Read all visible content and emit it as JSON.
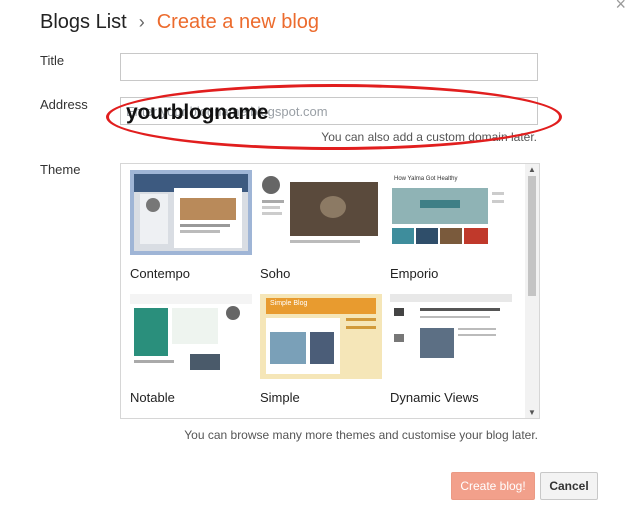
{
  "breadcrumb": {
    "parent": "Blogs List",
    "separator": "›",
    "current": "Create a new blog"
  },
  "close_glyph": "×",
  "form": {
    "title_label": "Title",
    "title_value": "",
    "address_label": "Address",
    "address_placeholder": "Enter your blogname.blogspot.com",
    "address_overlay": "yourblogname",
    "address_hint": "You can also add a custom domain later.",
    "theme_label": "Theme"
  },
  "themes": [
    {
      "name": "Contempo",
      "selected": true
    },
    {
      "name": "Soho",
      "selected": false
    },
    {
      "name": "Emporio",
      "selected": false
    },
    {
      "name": "Notable",
      "selected": false
    },
    {
      "name": "Simple",
      "selected": false
    },
    {
      "name": "Dynamic Views",
      "selected": false
    }
  ],
  "thumb_text": {
    "emporio_title": "How Yalma Got Healthy",
    "simple_title": "Simple Blog"
  },
  "themes_hint": "You can browse many more themes and customise your blog later.",
  "buttons": {
    "create": "Create blog!",
    "cancel": "Cancel"
  },
  "colors": {
    "accent": "#ec6b2d",
    "annotation": "#e11e1e",
    "create_button": "#f2a08b",
    "selection": "#9fb5d6"
  }
}
